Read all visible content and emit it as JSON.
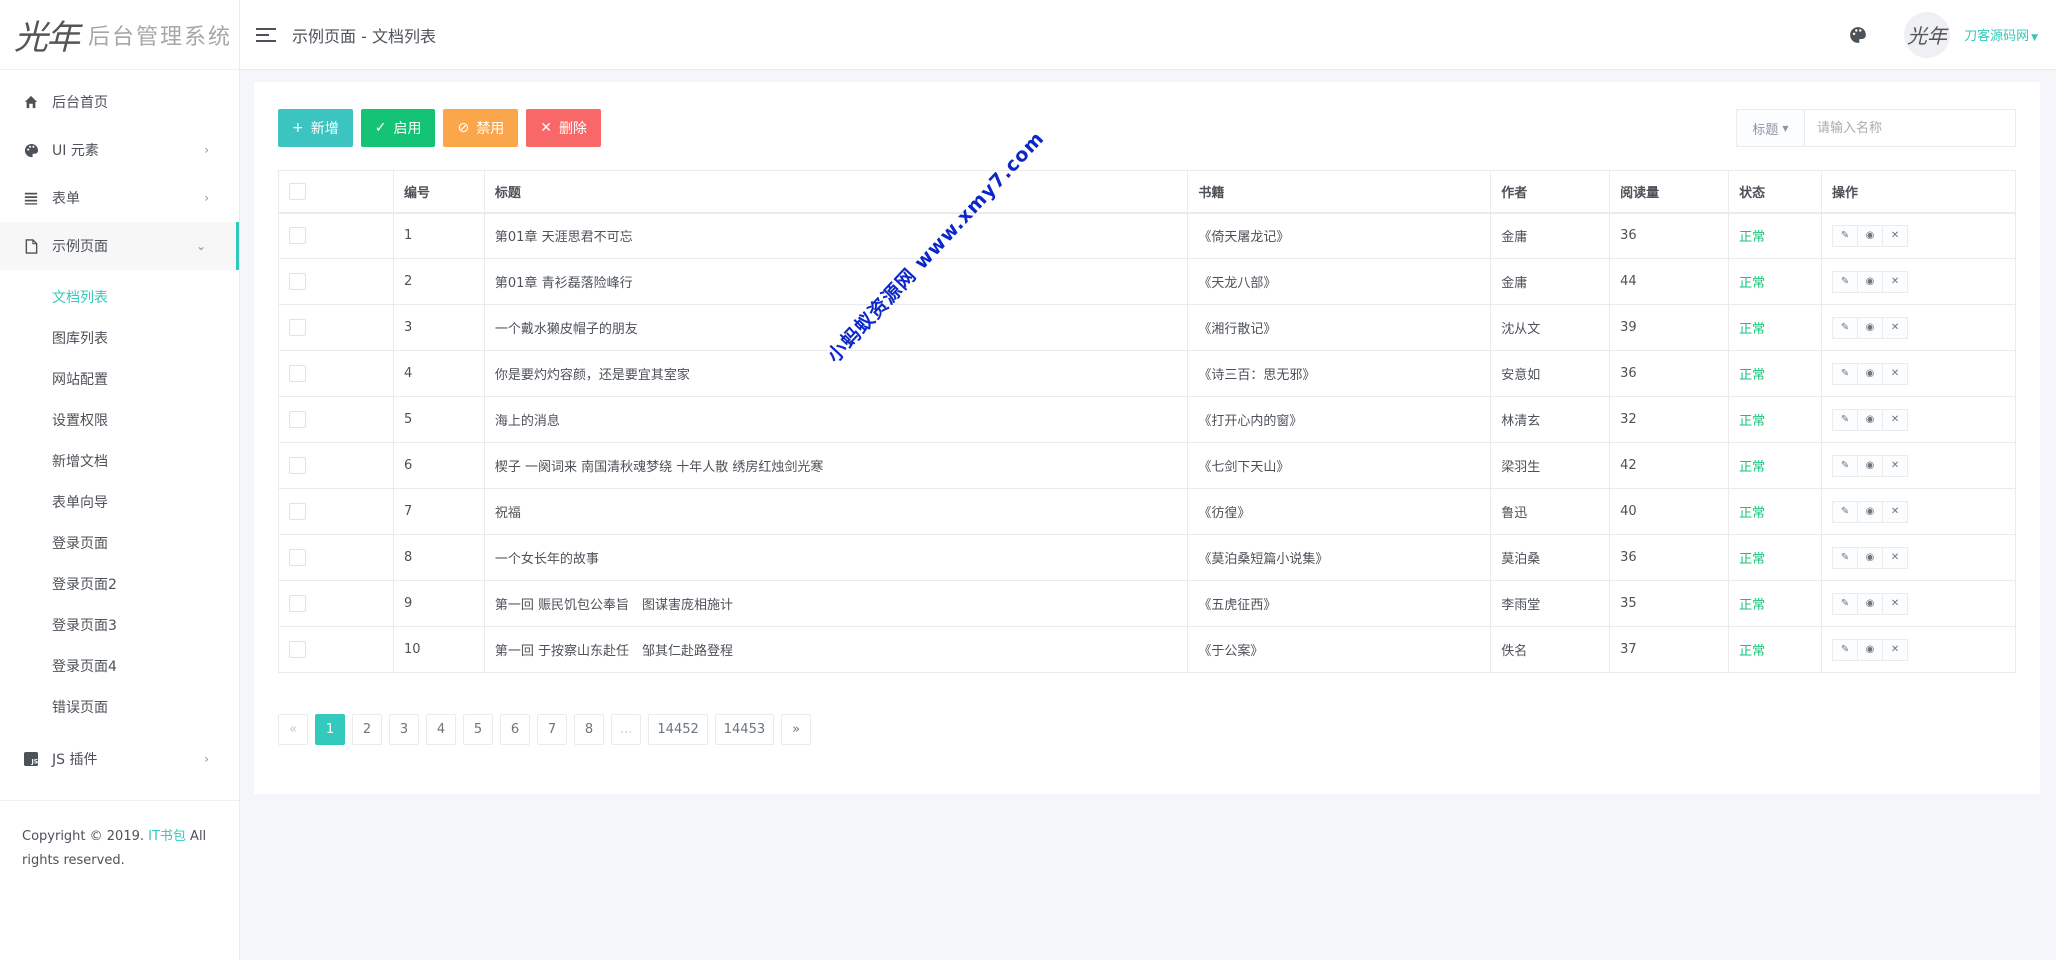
{
  "logo": {
    "mark": "光年",
    "text": "后台管理系统"
  },
  "header": {
    "title": "示例页面 - 文档列表",
    "user_name": "刀客源码网",
    "avatar_text": "光年"
  },
  "sidebar": {
    "items": [
      {
        "label": "后台首页",
        "icon": "home-icon"
      },
      {
        "label": "UI 元素",
        "icon": "palette-icon"
      },
      {
        "label": "表单",
        "icon": "list-icon"
      },
      {
        "label": "示例页面",
        "icon": "file-icon"
      },
      {
        "label": "JS 插件",
        "icon": "js-icon"
      }
    ],
    "sub_items": [
      {
        "label": "文档列表"
      },
      {
        "label": "图库列表"
      },
      {
        "label": "网站配置"
      },
      {
        "label": "设置权限"
      },
      {
        "label": "新增文档"
      },
      {
        "label": "表单向导"
      },
      {
        "label": "登录页面"
      },
      {
        "label": "登录页面2"
      },
      {
        "label": "登录页面3"
      },
      {
        "label": "登录页面4"
      },
      {
        "label": "错误页面"
      }
    ],
    "footer_prefix": "Copyright © 2019. ",
    "footer_link": "IT书包",
    "footer_suffix": " All rights reserved."
  },
  "toolbar": {
    "add_label": "新增",
    "enable_label": "启用",
    "disable_label": "禁用",
    "delete_label": "删除"
  },
  "search": {
    "select_label": "标题",
    "placeholder": "请输入名称"
  },
  "table": {
    "headers": [
      "编号",
      "标题",
      "书籍",
      "作者",
      "阅读量",
      "状态",
      "操作"
    ],
    "rows": [
      {
        "id": "1",
        "title": "第01章 天涯思君不可忘",
        "book": "《倚天屠龙记》",
        "author": "金庸",
        "reads": "36",
        "status": "正常"
      },
      {
        "id": "2",
        "title": "第01章 青衫磊落险峰行",
        "book": "《天龙八部》",
        "author": "金庸",
        "reads": "44",
        "status": "正常"
      },
      {
        "id": "3",
        "title": "一个戴水獭皮帽子的朋友",
        "book": "《湘行散记》",
        "author": "沈从文",
        "reads": "39",
        "status": "正常"
      },
      {
        "id": "4",
        "title": "你是要灼灼容颜，还是要宜其室家",
        "book": "《诗三百：思无邪》",
        "author": "安意如",
        "reads": "36",
        "status": "正常"
      },
      {
        "id": "5",
        "title": "海上的消息",
        "book": "《打开心内的窗》",
        "author": "林清玄",
        "reads": "32",
        "status": "正常"
      },
      {
        "id": "6",
        "title": "楔子 一阕词来 南国清秋魂梦绕 十年人散 绣房红烛剑光寒",
        "book": "《七剑下天山》",
        "author": "梁羽生",
        "reads": "42",
        "status": "正常"
      },
      {
        "id": "7",
        "title": "祝福",
        "book": "《彷徨》",
        "author": "鲁迅",
        "reads": "40",
        "status": "正常"
      },
      {
        "id": "8",
        "title": "一个女长年的故事",
        "book": "《莫泊桑短篇小说集》",
        "author": "莫泊桑",
        "reads": "36",
        "status": "正常"
      },
      {
        "id": "9",
        "title": "第一回 赈民饥包公奉旨　图谋害庞相施计",
        "book": "《五虎征西》",
        "author": "李雨堂",
        "reads": "35",
        "status": "正常"
      },
      {
        "id": "10",
        "title": "第一回 于按察山东赴任　邹其仁赴路登程",
        "book": "《于公案》",
        "author": "佚名",
        "reads": "37",
        "status": "正常"
      }
    ]
  },
  "pagination": {
    "prev": "«",
    "pages": [
      "1",
      "2",
      "3",
      "4",
      "5",
      "6",
      "7",
      "8",
      "...",
      "14452",
      "14453"
    ],
    "current": "1",
    "next": "»"
  },
  "watermark": "小蚂蚁资源网 www.xmy7.com",
  "colors": {
    "accent": "#33cabb",
    "success": "#15c377",
    "warning": "#faa64b",
    "danger": "#f96868"
  }
}
